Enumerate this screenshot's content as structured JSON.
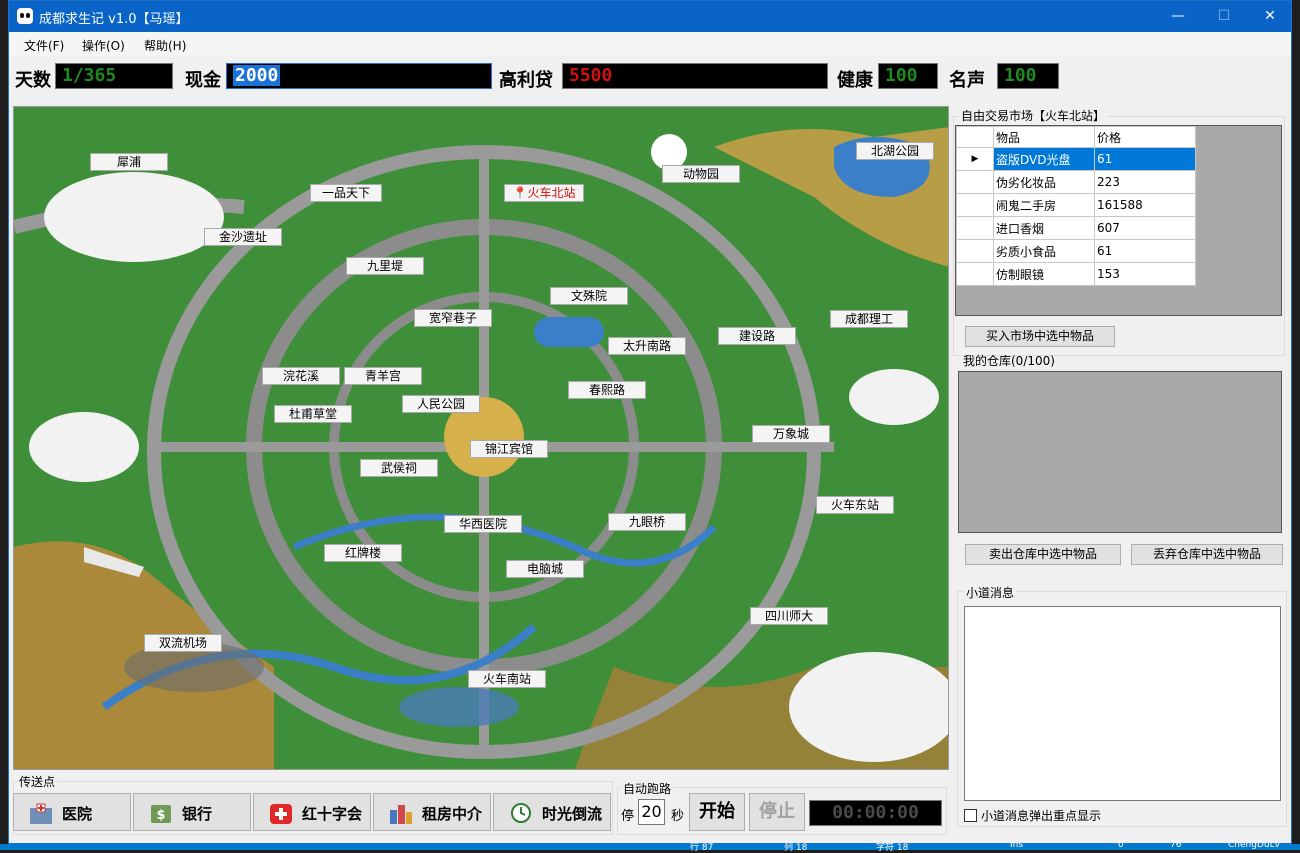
{
  "window": {
    "title": "成都求生记  v1.0【马瑶】",
    "controls": [
      "—",
      "☐",
      "✕"
    ]
  },
  "menu": [
    "文件(F)",
    "操作(O)",
    "帮助(H)"
  ],
  "stats": {
    "days_label": "天数",
    "days": "1/365",
    "cash_label": "现金",
    "cash": "2000",
    "debt_label": "高利贷",
    "debt": "5500",
    "health_label": "健康",
    "health": "100",
    "fame_label": "名声",
    "fame": "100"
  },
  "map_locations": [
    {
      "name": "犀浦"
    },
    {
      "name": "一品天下"
    },
    {
      "name": "火车北站"
    },
    {
      "name": "动物园"
    },
    {
      "name": "北湖公园"
    },
    {
      "name": "金沙遗址"
    },
    {
      "name": "九里堤"
    },
    {
      "name": "文殊院"
    },
    {
      "name": "成都理工"
    },
    {
      "name": "宽窄巷子"
    },
    {
      "name": "建设路"
    },
    {
      "name": "太升南路"
    },
    {
      "name": "浣花溪"
    },
    {
      "name": "青羊宫"
    },
    {
      "name": "春熙路"
    },
    {
      "name": "人民公园"
    },
    {
      "name": "杜甫草堂"
    },
    {
      "name": "万象城"
    },
    {
      "name": "锦江宾馆"
    },
    {
      "name": "武侯祠"
    },
    {
      "name": "火车东站"
    },
    {
      "name": "华西医院"
    },
    {
      "name": "九眼桥"
    },
    {
      "name": "红牌楼"
    },
    {
      "name": "电脑城"
    },
    {
      "name": "四川师大"
    },
    {
      "name": "双流机场"
    },
    {
      "name": "火车南站"
    }
  ],
  "market": {
    "title": "自由交易市场【火车北站】",
    "columns": [
      "物品",
      "价格"
    ],
    "rows": [
      {
        "item": "盗版DVD光盘",
        "price": "61"
      },
      {
        "item": "伪劣化妆品",
        "price": "223"
      },
      {
        "item": "闹鬼二手房",
        "price": "161588"
      },
      {
        "item": "进口香烟",
        "price": "607"
      },
      {
        "item": "劣质小食品",
        "price": "61"
      },
      {
        "item": "仿制眼镜",
        "price": "153"
      }
    ],
    "buy_label": "买入市场中选中物品"
  },
  "storage": {
    "title": "我的仓库(0/100)",
    "sell_label": "卖出仓库中选中物品",
    "discard_label": "丢弃仓库中选中物品"
  },
  "messages": {
    "title": "小道消息",
    "popup_label": "小道消息弹出重点显示"
  },
  "teleport": {
    "title": "传送点",
    "buttons": [
      "医院",
      "银行",
      "红十字会",
      "租房中介",
      "时光倒流"
    ]
  },
  "auto_run": {
    "title": "自动跑路",
    "stop_prefix": "停",
    "seconds": "20",
    "unit": "秒",
    "start_label": "开始",
    "stop_label": "停止",
    "timer": "00:00:00"
  },
  "statusbar": [
    "行 87",
    "列 18",
    "字符 18",
    "Ins",
    "0",
    "76",
    "ChengDuLv"
  ],
  "colors": {
    "titlebar": "#0a64c8",
    "selected": "#0078d7",
    "led_green": "#1f8a1f",
    "led_red": "#d01010"
  }
}
